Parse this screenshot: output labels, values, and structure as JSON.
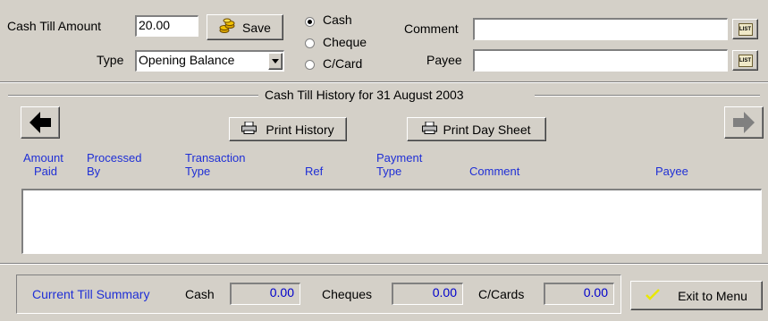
{
  "top": {
    "cash_till_label": "Cash Till Amount",
    "cash_till_value": "20.00",
    "save_label": "Save",
    "type_label": "Type",
    "type_value": "Opening Balance",
    "payment_options": [
      "Cash",
      "Cheque",
      "C/Card"
    ],
    "selected_payment": "Cash",
    "comment_label": "Comment",
    "comment_value": "",
    "payee_label": "Payee",
    "payee_value": "",
    "list_icon_text": "LIST"
  },
  "history": {
    "title": "Cash Till History for 31 August 2003",
    "print_history_label": "Print History",
    "print_day_sheet_label": "Print Day Sheet",
    "columns": [
      {
        "line1": "Amount",
        "line2": "Paid"
      },
      {
        "line1": "Processed",
        "line2": "By"
      },
      {
        "line1": "Transaction",
        "line2": "Type"
      },
      {
        "line1": "",
        "line2": "Ref"
      },
      {
        "line1": "Payment",
        "line2": "Type"
      },
      {
        "line1": "",
        "line2": "Comment"
      },
      {
        "line1": "Payee",
        "line2": ""
      }
    ],
    "rows": []
  },
  "summary": {
    "title": "Current Till Summary",
    "cash_label": "Cash",
    "cash_value": "0.00",
    "cheques_label": "Cheques",
    "cheques_value": "0.00",
    "ccards_label": "C/Cards",
    "ccards_value": "0.00",
    "exit_label": "Exit to Menu"
  },
  "colors": {
    "background": "#d4d0c8",
    "header_text": "#1f2fd6",
    "value_text": "#0000cc",
    "check": "#e8e800"
  }
}
